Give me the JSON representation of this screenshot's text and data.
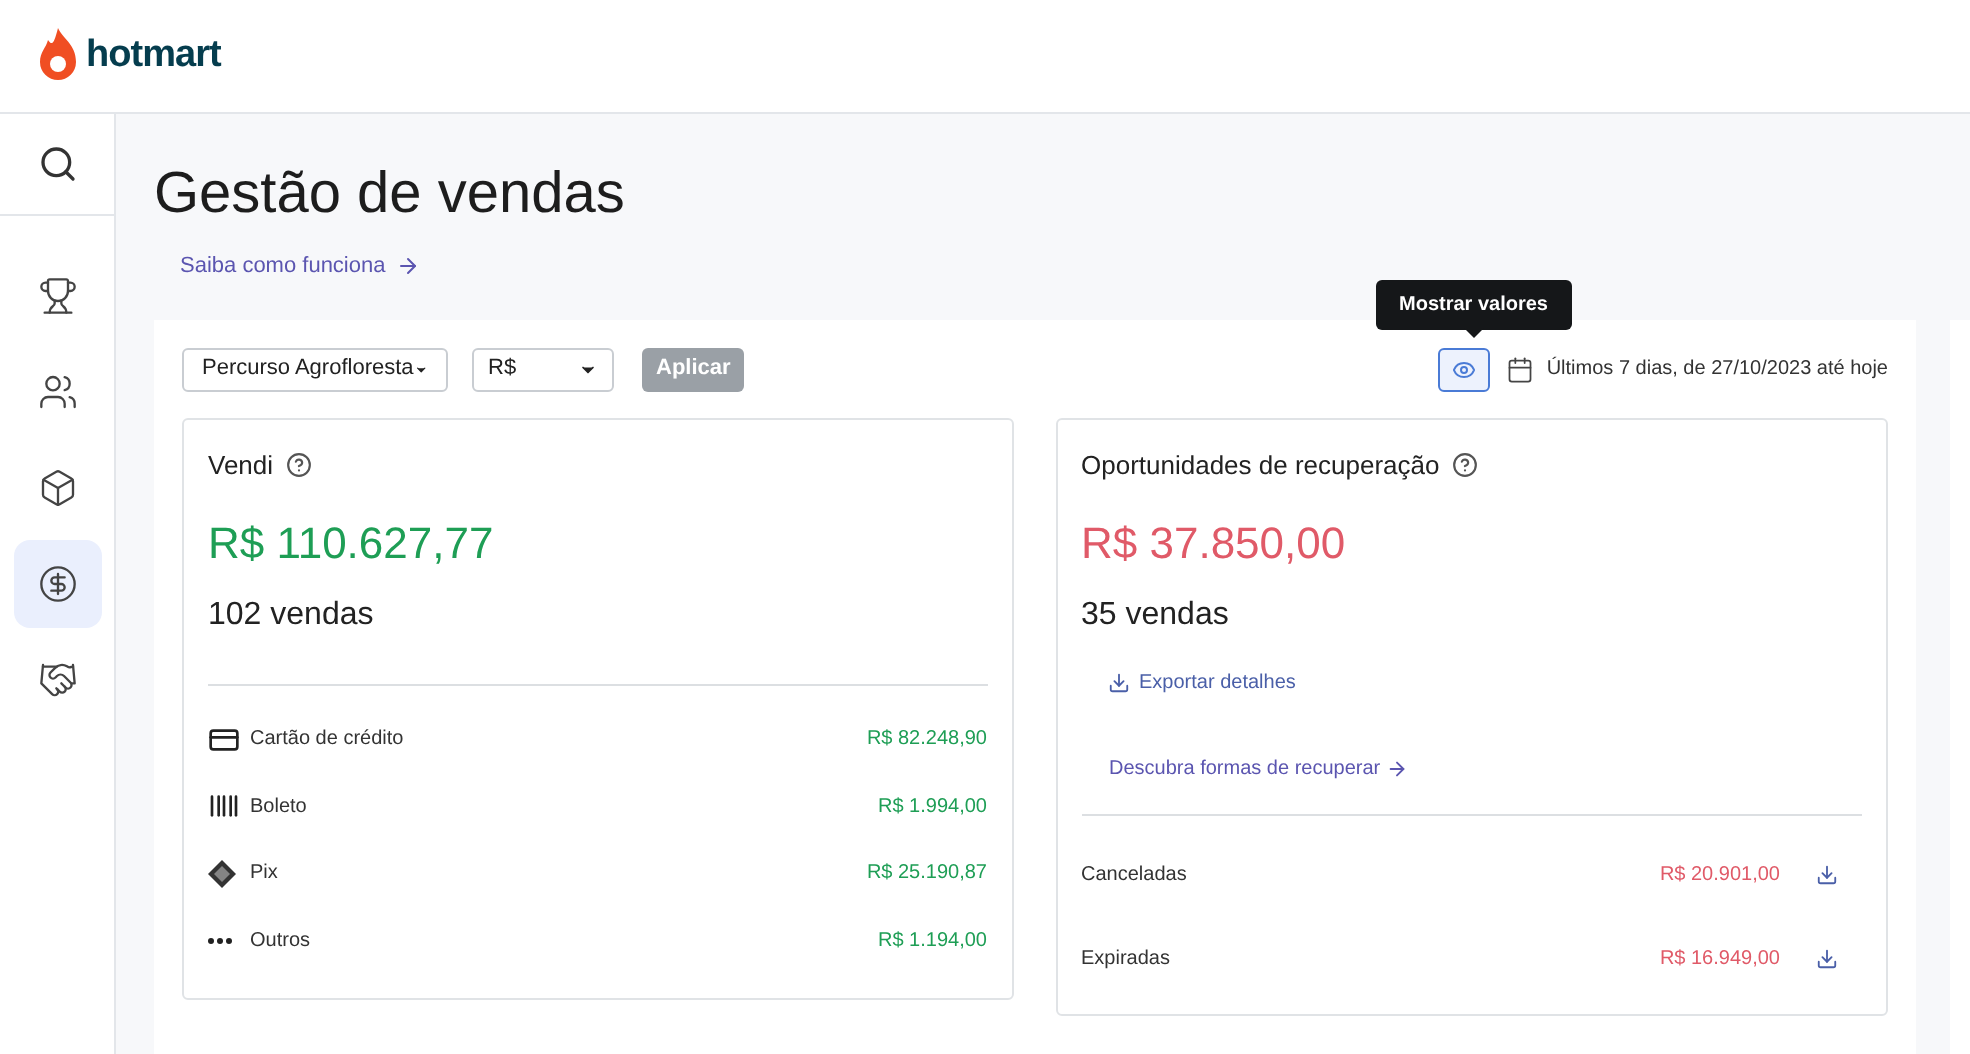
{
  "header": {
    "logo": "hotmart"
  },
  "sidebar": {
    "items": [
      {
        "kind": "trophy",
        "selected": false
      },
      {
        "kind": "people",
        "selected": false
      },
      {
        "kind": "box",
        "selected": false
      },
      {
        "kind": "dollar",
        "selected": true
      },
      {
        "kind": "handshake",
        "selected": false
      }
    ]
  },
  "page": {
    "title": "Gestão de vendas",
    "help_link": "Saiba como funciona"
  },
  "filters": {
    "product": "Percurso Agrofloresta",
    "currency": "R$",
    "apply_button": {
      "label": "Aplicar",
      "disabled": true
    },
    "tooltip": "Mostrar valores",
    "date_range": "Últimos 7 dias, de 27/10/2023 até hoje"
  },
  "sold_card": {
    "title": "Vendi",
    "amount": "R$ 110.627,77",
    "count": "102 vendas",
    "methods": [
      {
        "kind": "card",
        "label": "Cartão de crédito",
        "value": "R$ 82.248,90"
      },
      {
        "kind": "barcode",
        "label": "Boleto",
        "value": "R$ 1.994,00"
      },
      {
        "kind": "pix",
        "label": "Pix",
        "value": "R$ 25.190,87"
      },
      {
        "kind": "dots",
        "label": "Outros",
        "value": "R$ 1.194,00"
      }
    ]
  },
  "recovery_card": {
    "title": "Oportunidades de recuperação",
    "amount": "R$ 37.850,00",
    "count": "35 vendas",
    "export_link": "Exportar detalhes",
    "discover_link": "Descubra formas de recuperar",
    "rows": [
      {
        "label": "Canceladas",
        "value": "R$ 20.901,00"
      },
      {
        "label": "Expiradas",
        "value": "R$ 16.949,00"
      }
    ]
  }
}
